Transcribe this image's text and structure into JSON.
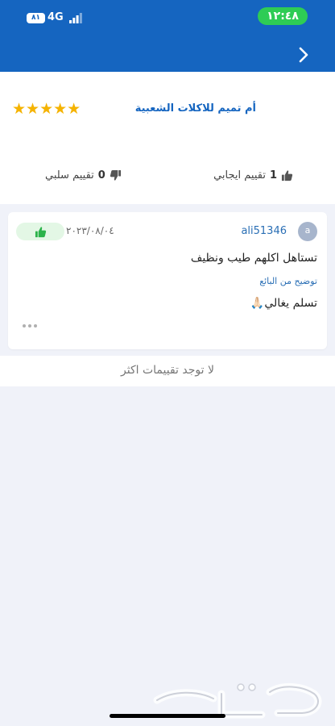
{
  "status_bar": {
    "time": "١٢:٤٨",
    "battery": "٨١",
    "network": "4G"
  },
  "seller": {
    "name": "أم تميم للاكلات الشعبية",
    "stars": "★★★★★",
    "positive_count": "1",
    "positive_label": "تقييم ايجابي",
    "negative_count": "0",
    "negative_label": "تقييم سلبي"
  },
  "review": {
    "avatar_letter": "a",
    "username": "ali51346",
    "date": "٢٠٢٣/٠٨/٠٤",
    "text": "تستاهل اكلهم طيب ونظيف",
    "seller_reply_label": "توضيح من البائع",
    "seller_reply_text": "تسلم يغالي🙏🏻"
  },
  "footer": {
    "no_more_ratings": "لا توجد تقييمات اكثر"
  },
  "colors": {
    "header": "#1565c0",
    "accent_green": "#2ecc55",
    "star": "#f5b300",
    "link_blue": "#2a6fb5"
  },
  "icons": {
    "back": "chevron-right-icon",
    "thumbs_up": "thumbs-up-icon",
    "thumbs_down": "thumbs-down-icon",
    "more": "more-horizontal-icon"
  }
}
